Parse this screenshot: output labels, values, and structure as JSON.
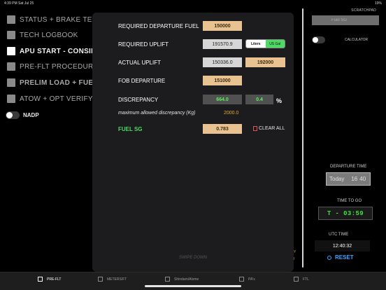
{
  "status_bar": {
    "time": "4:39 PM  Sat Jul 25",
    "right": "19%"
  },
  "checklist": [
    {
      "label": "STATUS + BRAKE TEM",
      "state": "normal"
    },
    {
      "label": "TECH LOGBOOK",
      "state": "normal"
    },
    {
      "label": "APU START - CONSID",
      "state": "active"
    },
    {
      "label": "PRE-FLT PROCEDUR",
      "state": "normal"
    },
    {
      "label": "PRELIM LOAD + FUEL",
      "state": "bold"
    },
    {
      "label": "ATOW + OPT VERIFY",
      "state": "normal"
    }
  ],
  "nadp": {
    "label": "NADP"
  },
  "right_panel": {
    "scratchpad_label": "SCRATCHPAD",
    "scratchpad_value": "Fuel SG",
    "calculator_label": "CALCULATOR",
    "departure_time_label": "DEPARTURE TIME",
    "departure_day": "Today",
    "departure_hour": "16",
    "departure_min": "40",
    "time_to_go_label": "TIME TO GO",
    "time_to_go_value": "T - 03:59",
    "utc_time_label": "UTC TIME",
    "utc_time_value": "12:40:32",
    "reset_label": "RESET"
  },
  "tabs": [
    {
      "label": "PRE-FLT",
      "active": true
    },
    {
      "label": "METERS/FT",
      "active": false
    },
    {
      "label": "Shindam/Alome",
      "active": false
    },
    {
      "label": "PA's",
      "active": false
    },
    {
      "label": "FTL",
      "active": false
    }
  ],
  "fuel_modal": {
    "required_departure_fuel_label": "REQUIRED DEPARTURE FUEL",
    "required_departure_fuel_value": "150000",
    "required_uplift_label": "REQUIRED UPLIFT",
    "required_uplift_value": "191570.9",
    "unit_liters": "Liters",
    "unit_usgal": "US Gal",
    "actual_uplift_label": "ACTUAL UPLIFT",
    "actual_uplift_liters": "150336.0",
    "actual_uplift_kg": "192000",
    "fob_departure_label": "FOB DEPARTURE",
    "fob_departure_value": "151000",
    "discrepancy_label": "DISCREPANCY",
    "discrepancy_value": "664.0",
    "discrepancy_pct": "0.4",
    "pct_symbol": "%",
    "max_discrepancy_label": "maximum allowed discrepancy (Kg)",
    "max_discrepancy_value": "2000.0",
    "fuel_sg_label": "FUEL SG",
    "fuel_sg_value": "0.783",
    "clear_all_label": "CLEAR ALL",
    "swipe_hint": "SWIPE DOWN"
  },
  "colors": {
    "tan_field": "#e8c290",
    "green_accent": "#4cd964",
    "orange_text": "#e8a43a",
    "reset_blue": "#3aa6ff"
  }
}
